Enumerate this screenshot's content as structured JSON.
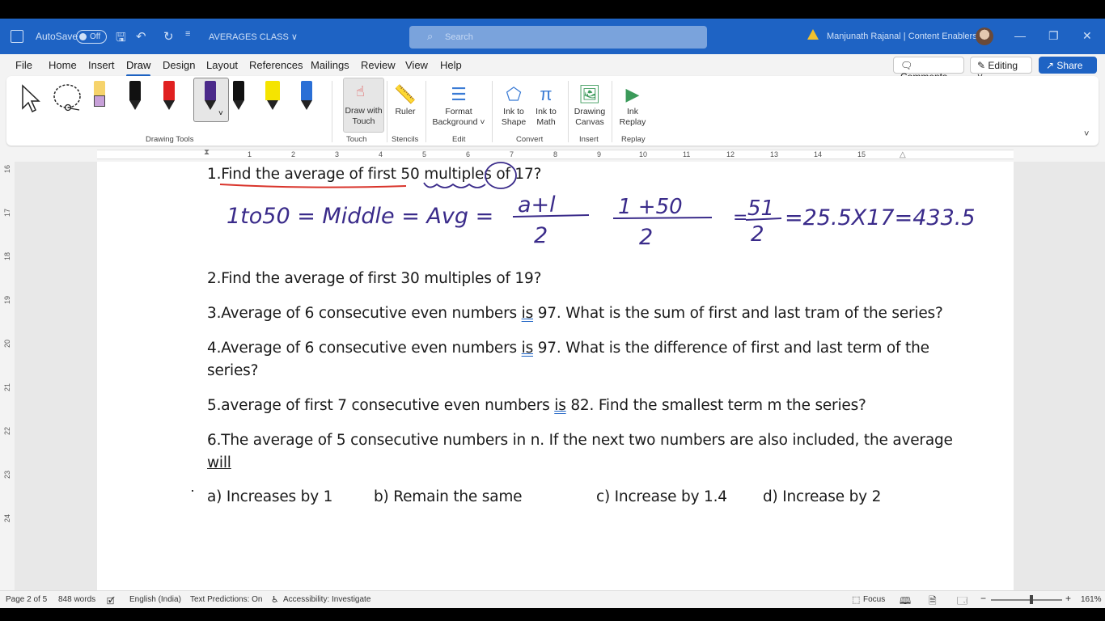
{
  "titlebar": {
    "autosave_label": "AutoSave",
    "autosave_state": "Off",
    "doc_title": "AVERAGES CLASS ∨",
    "search_placeholder": "Search",
    "user_name": "Manjunath Rajanal | Content Enablers"
  },
  "menu": {
    "tabs": [
      "File",
      "Home",
      "Insert",
      "Draw",
      "Design",
      "Layout",
      "References",
      "Mailings",
      "Review",
      "View",
      "Help"
    ],
    "active_tab": "Draw",
    "comments_label": "Comments",
    "editing_label": "Editing",
    "share_label": "Share"
  },
  "ribbon": {
    "groups": {
      "drawing_tools": "Drawing Tools",
      "touch": "Touch",
      "stencils": "Stencils",
      "edit": "Edit",
      "convert": "Convert",
      "insert": "Insert",
      "replay": "Replay"
    },
    "draw_with_touch": [
      "Draw with",
      "Touch"
    ],
    "ruler": "Ruler",
    "format_background": [
      "Format",
      "Background ˅"
    ],
    "ink_to_shape": [
      "Ink to",
      "Shape"
    ],
    "ink_to_math": [
      "Ink to",
      "Math"
    ],
    "drawing_canvas": [
      "Drawing",
      "Canvas"
    ],
    "ink_replay": [
      "Ink",
      "Replay"
    ],
    "pen_colors": [
      "#f6d36b",
      "#111111",
      "#e02020",
      "#4b2a8a",
      "#111111",
      "#f5e400",
      "#2a6fd6"
    ]
  },
  "ruler": {
    "numbers": [
      "1",
      "2",
      "3",
      "4",
      "5",
      "6",
      "7",
      "8",
      "9",
      "10",
      "11",
      "12",
      "13",
      "14",
      "15"
    ],
    "vertical_numbers": [
      "16",
      "17",
      "18",
      "19",
      "20",
      "21",
      "22",
      "23",
      "24"
    ]
  },
  "document": {
    "q1": "1.Find the average of first 50 multiples of 17?",
    "q2": "2.Find the average of first 30 multiples of 19?",
    "q3_a": "3.Average of 6 consecutive even numbers ",
    "q3_is": "is",
    "q3_b": " 97. What is the sum of first and last tram of the series?",
    "q4_a": "4.Average of 6 consecutive even numbers ",
    "q4_is": "is",
    "q4_b": " 97. What is the difference of first and last term of the",
    "q4_c": "series?",
    "q5_a": "5.average of first 7 consecutive even numbers ",
    "q5_is": "is",
    "q5_b": " 82. Find the smallest term m the series?",
    "q6_a": "6.The average of 5 consecutive numbers in n. If the next two numbers are also included, the average",
    "q6_b": "will",
    "opt_a": "a) Increases by 1",
    "opt_b": "b) Remain the same",
    "opt_c": "c) Increase by 1.4",
    "opt_d": "d) Increase by 2",
    "ink_color": "#3a2b8a",
    "ink_line1": "1to50 = Middle = Avg = a+l/2 = 1+50/2 = 51/2 = 25.5 X 17 = 433.5"
  },
  "status": {
    "page": "Page 2 of 5",
    "words": "848 words",
    "language": "English (India)",
    "text_predictions": "Text Predictions: On",
    "accessibility": "Accessibility: Investigate",
    "focus": "Focus",
    "zoom": "161%"
  }
}
